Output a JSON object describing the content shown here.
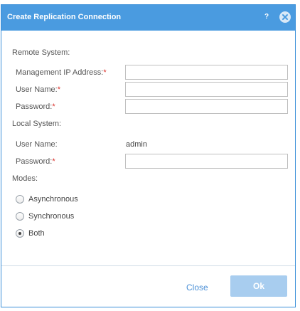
{
  "dialog": {
    "title": "Create Replication Connection",
    "help_glyph": "?",
    "accent_color": "#4a9be0"
  },
  "remote": {
    "section_label": "Remote System:",
    "mgmt_ip_label": "Management IP Address:",
    "mgmt_ip_value": "",
    "username_label": "User Name:",
    "username_value": "",
    "password_label": "Password:",
    "password_value": ""
  },
  "local": {
    "section_label": "Local System:",
    "username_label": "User Name:",
    "username_value": "admin",
    "password_label": "Password:",
    "password_value": ""
  },
  "modes": {
    "section_label": "Modes:",
    "options": [
      {
        "label": "Asynchronous",
        "selected": false
      },
      {
        "label": "Synchronous",
        "selected": false
      },
      {
        "label": "Both",
        "selected": true
      }
    ]
  },
  "footer": {
    "close_label": "Close",
    "ok_label": "Ok"
  },
  "required_mark": "*"
}
